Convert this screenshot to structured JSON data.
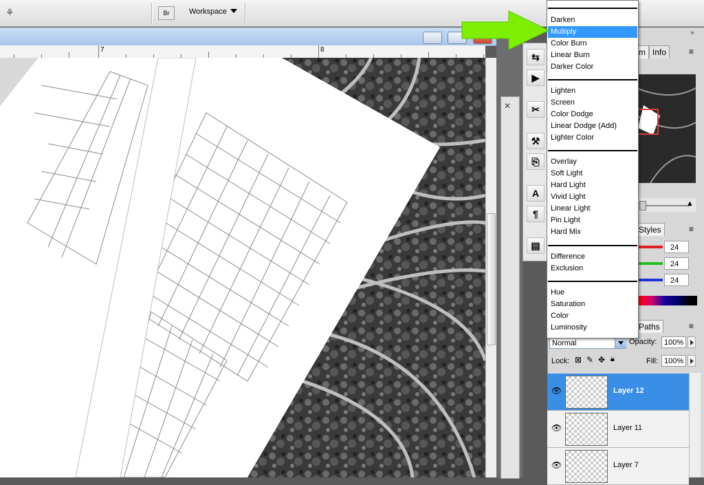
{
  "toolbar": {
    "workspace_label": "Workspace"
  },
  "ruler": {
    "marks": [
      "7",
      "8"
    ]
  },
  "panels": {
    "navigator_tabs": [
      "m",
      "Info"
    ],
    "styles_tab": "Styles",
    "paths_tab": "Paths",
    "color_values": {
      "r": "24",
      "g": "24",
      "b": "24"
    }
  },
  "layers": {
    "blend_mode": "Normal",
    "opacity_label": "Opacity:",
    "opacity_value": "100%",
    "lock_label": "Lock:",
    "fill_label": "Fill:",
    "fill_value": "100%",
    "items": [
      {
        "name": "Layer 12",
        "selected": true
      },
      {
        "name": "Layer 11",
        "selected": false
      },
      {
        "name": "Layer 7",
        "selected": false
      }
    ]
  },
  "blend_menu": {
    "groups": [
      [
        "Darken",
        "Multiply",
        "Color Burn",
        "Linear Burn",
        "Darker Color"
      ],
      [
        "Lighten",
        "Screen",
        "Color Dodge",
        "Linear Dodge (Add)",
        "Lighter Color"
      ],
      [
        "Overlay",
        "Soft Light",
        "Hard Light",
        "Vivid Light",
        "Linear Light",
        "Pin Light",
        "Hard Mix"
      ],
      [
        "Difference",
        "Exclusion"
      ],
      [
        "Hue",
        "Saturation",
        "Color",
        "Luminosity"
      ]
    ],
    "highlighted": "Multiply"
  },
  "colors": {
    "highlight": "#3399ff",
    "arrow": "#7cf000",
    "layer_selected": "#3a8ee6"
  }
}
